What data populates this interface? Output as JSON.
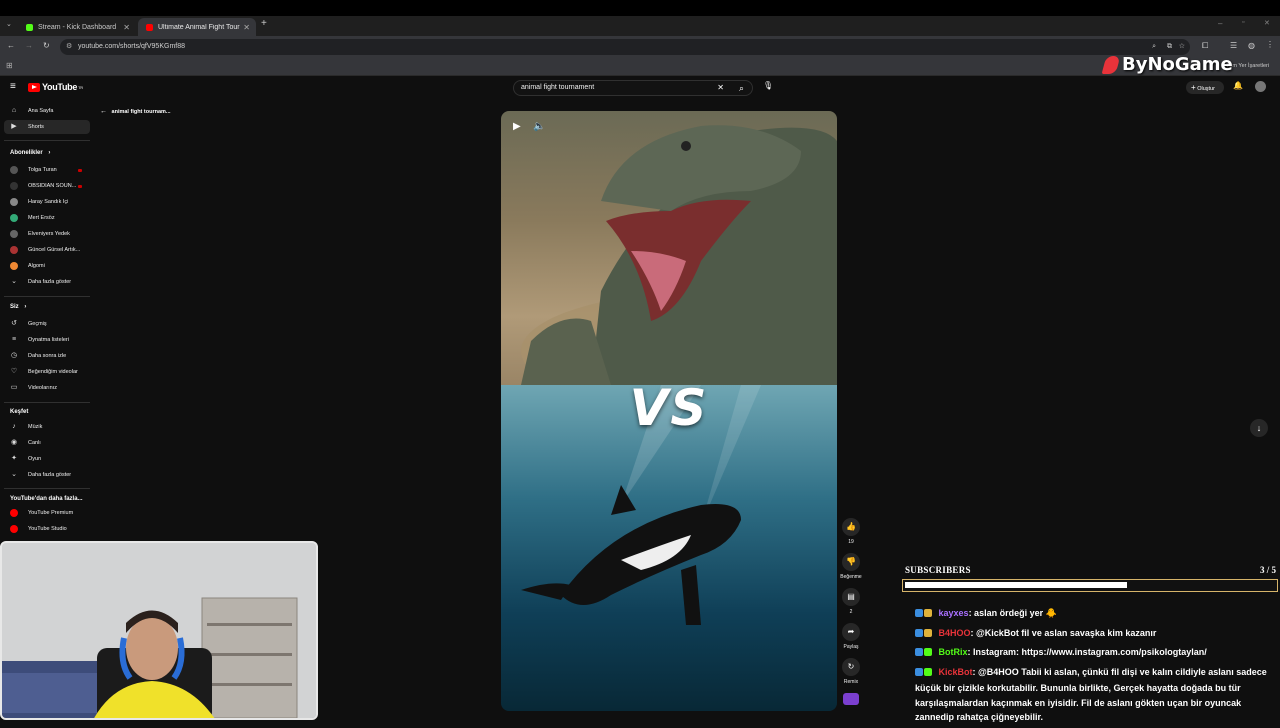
{
  "browser": {
    "tabs": [
      {
        "title": "Stream - Kick Dashboard",
        "favicon_color": "#53fc18"
      },
      {
        "title": "Ultimate Animal Fight Tournam",
        "favicon_color": "#ff0000"
      }
    ],
    "url": "youtube.com/shorts/qfV95KGmf88",
    "bookmarks_right": "Tüm Yer İşaretleri"
  },
  "watermark": "ByNoGame",
  "header": {
    "logo": "YouTube",
    "country": "TR",
    "search_value": "animal fight tournament",
    "create_label": "Oluştur"
  },
  "back_label": "animal fight tournam...",
  "sidebar": {
    "main": [
      {
        "label": "Ana Sayfa",
        "icon": "home-icon",
        "glyph": "⌂"
      },
      {
        "label": "Shorts",
        "icon": "shorts-icon",
        "glyph": "▶"
      }
    ],
    "subs_title": "Abonelikler",
    "subs": [
      {
        "label": "Tolga Turan",
        "color": "#555"
      },
      {
        "label": "OBSIDIAN SOUN...",
        "color": "#333"
      },
      {
        "label": "Haray Sandık İçi",
        "color": "#888"
      },
      {
        "label": "Mert Ersöz",
        "color": "#3a7"
      },
      {
        "label": "Elveniyers Yedek",
        "color": "#666"
      },
      {
        "label": "Güncel Gürsel Artık...",
        "color": "#a33"
      },
      {
        "label": "Algomi",
        "color": "#e83"
      }
    ],
    "subs_more": "Daha fazla göster",
    "you_title": "Siz",
    "you": [
      {
        "label": "Geçmiş",
        "icon": "history-icon",
        "glyph": "↺"
      },
      {
        "label": "Oynatma listeleri",
        "icon": "playlists-icon",
        "glyph": "≡"
      },
      {
        "label": "Daha sonra izle",
        "icon": "watch-later-icon",
        "glyph": "◷"
      },
      {
        "label": "Beğendiğim videolar",
        "icon": "like-icon",
        "glyph": "♡"
      },
      {
        "label": "Videolarınız",
        "icon": "your-videos-icon",
        "glyph": "▭"
      }
    ],
    "explore_title": "Keşfet",
    "explore": [
      {
        "label": "Müzik",
        "icon": "music-icon",
        "glyph": "♪"
      },
      {
        "label": "Canlı",
        "icon": "live-icon",
        "glyph": "◉"
      },
      {
        "label": "Oyun",
        "icon": "gaming-icon",
        "glyph": "✦"
      },
      {
        "label": "Daha fazla göster",
        "icon": "chevron-down-icon",
        "glyph": "⌄"
      }
    ],
    "more_title": "YouTube'dan daha fazla...",
    "more": [
      {
        "label": "YouTube Premium",
        "color": "#ff0000"
      },
      {
        "label": "YouTube Studio",
        "color": "#ff0000"
      }
    ]
  },
  "video": {
    "overlay_text": "VS"
  },
  "rail": {
    "like_count": "19",
    "dislike_label": "Beğenme",
    "comment_count": "2",
    "share_label": "Paylaş",
    "remix_label": "Remix"
  },
  "overlay": {
    "subs_title": "SUBSCRIBERS",
    "subs_count": "3 / 5",
    "subs_progress": 0.6,
    "accent": "#d6b46a"
  },
  "chat": [
    {
      "user": "kayxes",
      "color": "#a970ff",
      "text": ": aslan ördeği yer 🐥"
    },
    {
      "user": "B4HOO",
      "color": "#e8333a",
      "text": ": @KickBot fil ve aslan savaşka kim kazanır"
    },
    {
      "user": "BotRix",
      "color": "#53fc18",
      "text": ": Instagram: https://www.instagram.com/psikologtaylan/"
    },
    {
      "user": "KickBot",
      "color": "#e8333a",
      "text": ": @B4HOO Tabii ki aslan, çünkü fil dişi ve kalın cildiyle aslanı sadece küçük bir çizikle korkutabilir. Bununla birlikte, Gerçek hayatta doğada bu tür karşılaşmalardan kaçınmak en iyisidir. Fil de aslanı gökten uçan bir oyuncak zannedip rahatça çiğneyebilir."
    }
  ]
}
